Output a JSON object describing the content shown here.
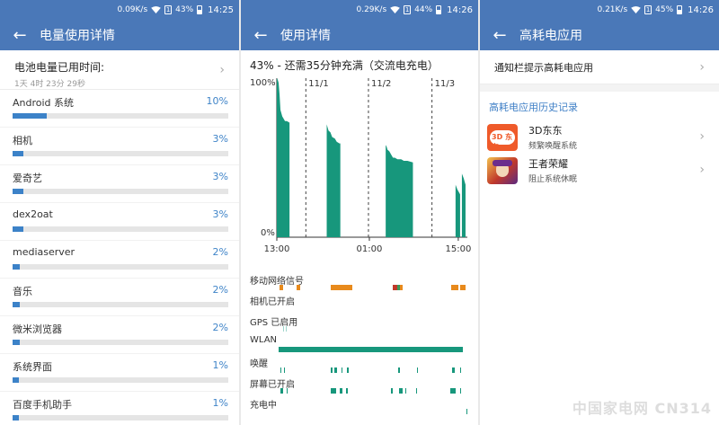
{
  "colors": {
    "header": "#4a78b8",
    "accent_blue": "#3c82c8",
    "chart_teal": "#17977c",
    "orange": "#e88a1c",
    "red": "#c0392b"
  },
  "panel1": {
    "status": {
      "speed": "0.09K/s",
      "battery": "43%",
      "time": "14:25"
    },
    "title": "电量使用详情",
    "usage_label": "电池电量已用时间:",
    "usage_time": "1天 4时 23分 29秒",
    "apps": [
      {
        "name": "Android 系统",
        "pct": "10%",
        "level": 0.1
      },
      {
        "name": "相机",
        "pct": "3%",
        "level": 0.03
      },
      {
        "name": "爱奇艺",
        "pct": "3%",
        "level": 0.03
      },
      {
        "name": "dex2oat",
        "pct": "3%",
        "level": 0.03
      },
      {
        "name": "mediaserver",
        "pct": "2%",
        "level": 0.02
      },
      {
        "name": "音乐",
        "pct": "2%",
        "level": 0.02
      },
      {
        "name": "微米浏览器",
        "pct": "2%",
        "level": 0.02
      },
      {
        "name": "系统界面",
        "pct": "1%",
        "level": 0.01
      },
      {
        "name": "百度手机助手",
        "pct": "1%",
        "level": 0.01
      }
    ]
  },
  "panel2": {
    "status": {
      "speed": "0.29K/s",
      "battery": "44%",
      "time": "14:26"
    },
    "title": "使用详情",
    "charge_text": "43% - 还需35分钟充满（交流电充电）",
    "chart_data": {
      "type": "area",
      "y_labels": [
        "100%",
        "0%"
      ],
      "ylim": [
        0,
        100
      ],
      "date_markers": [
        "11/1",
        "11/2",
        "11/3"
      ],
      "time_ticks": [
        "13:00",
        "01:00",
        "15:00"
      ],
      "segments": [
        {
          "x": [
            0,
            1,
            2,
            3,
            4,
            6,
            9,
            11,
            14
          ],
          "y": [
            100,
            99,
            97,
            90,
            80,
            76,
            73,
            73,
            72
          ]
        },
        {
          "x": [
            55,
            56,
            57,
            59,
            61,
            64,
            66,
            69,
            70
          ],
          "y": [
            71,
            69,
            67,
            66,
            63,
            62,
            60,
            59,
            59
          ]
        },
        {
          "x": [
            120,
            121,
            122,
            124,
            126,
            128,
            130,
            133,
            137,
            140,
            144,
            150
          ],
          "y": [
            58,
            57,
            55,
            54,
            52,
            50,
            50,
            49,
            49,
            48,
            48,
            47
          ]
        },
        {
          "x": [
            197,
            199,
            202
          ],
          "y": [
            33,
            30,
            27
          ]
        },
        {
          "x": [
            204,
            206,
            208
          ],
          "y": [
            40,
            37,
            33
          ]
        }
      ]
    },
    "timelines": [
      {
        "label": "移动网络信号"
      },
      {
        "label": "相机已开启"
      },
      {
        "label": "GPS 已启用"
      },
      {
        "label": "WLAN"
      },
      {
        "label": "唤醒"
      },
      {
        "label": "屏幕已开启"
      },
      {
        "label": "充电中"
      }
    ]
  },
  "panel3": {
    "status": {
      "speed": "0.21K/s",
      "battery": "45%",
      "time": "14:26"
    },
    "title": "高耗电应用",
    "notify_row": "通知栏提示高耗电应用",
    "history_title": "高耗电应用历史记录",
    "apps": [
      {
        "name": "3D东东",
        "desc": "频繁唤醒系统",
        "icon": "3d-dongdong-icon",
        "icon_text": "3D 东东"
      },
      {
        "name": "王者荣耀",
        "desc": "阻止系统休眠",
        "icon": "honor-of-kings-icon"
      }
    ]
  },
  "watermark": "中国家电网 CN314"
}
